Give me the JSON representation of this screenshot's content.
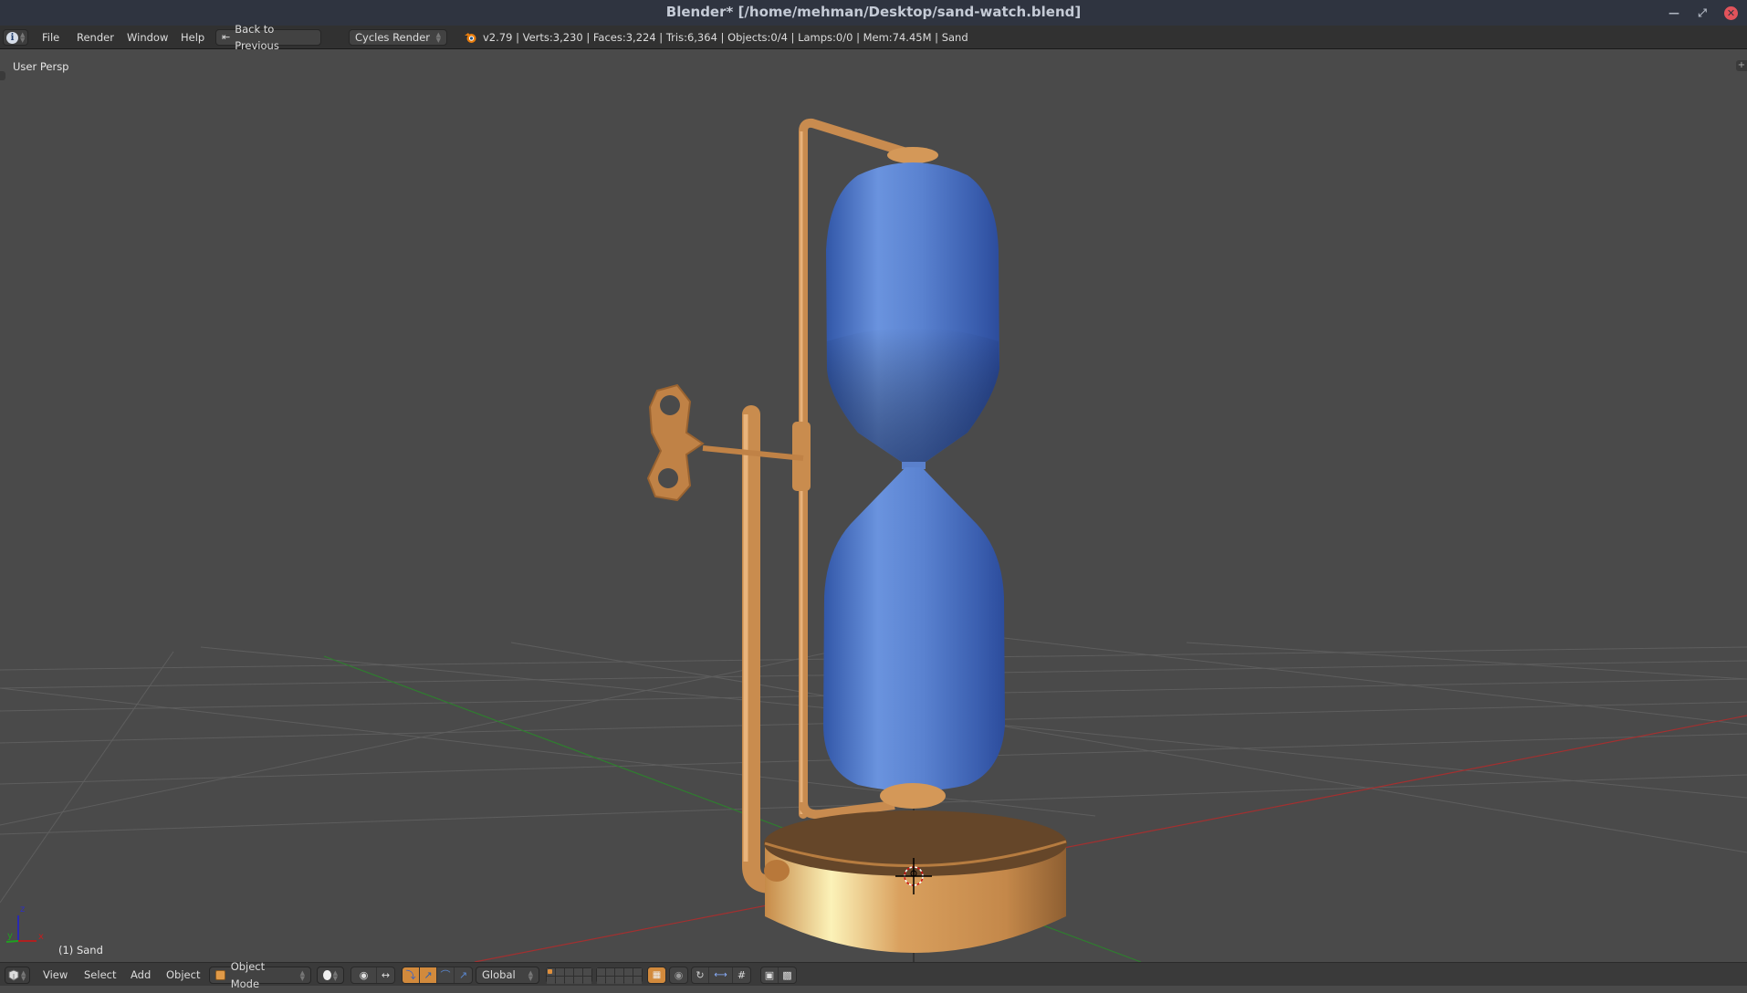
{
  "window": {
    "title": "Blender* [/home/mehman/Desktop/sand-watch.blend]",
    "controls": {
      "minimize_icon": "minimize-icon",
      "maximize_icon": "maximize-icon",
      "close_icon": "close-icon"
    }
  },
  "info_header": {
    "editor_type_icon": "info-icon",
    "menus": [
      "File",
      "Render",
      "Window",
      "Help"
    ],
    "back_button_label": "Back to Previous",
    "render_engine": "Cycles Render",
    "stats": "v2.79 | Verts:3,230 | Faces:3,224 | Tris:6,364 | Objects:0/4 | Lamps:0/0 | Mem:74.45M | Sand"
  },
  "viewport": {
    "view_label": "User Persp",
    "object_label": "(1) Sand",
    "axis_labels": {
      "x": "x",
      "y": "y",
      "z": "z"
    },
    "colors": {
      "background": "#4a4a4a",
      "grid": "#5c5c5c",
      "x_axis": "#9e2a2a",
      "y_axis": "#2a7a2a",
      "glass_blue": "#3d64b8",
      "copper": "#c98c4e"
    }
  },
  "bottom_header": {
    "editor_type_icon": "3d-view-icon",
    "menus": [
      "View",
      "Select",
      "Add",
      "Object"
    ],
    "mode": "Object Mode",
    "transform_orientation": "Global",
    "active_layer": 1,
    "accent_color": "#d28a3c"
  }
}
